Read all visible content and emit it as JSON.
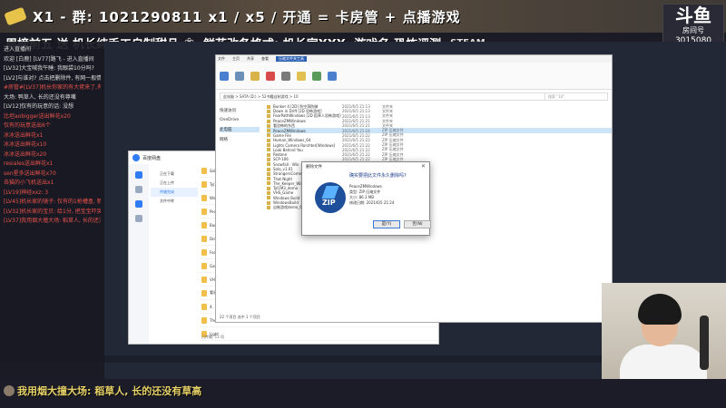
{
  "banner": {
    "text": "X1 - 群: 1021290811 x1 / x5 / 开通 = 卡房管 + 点播游戏",
    "sub": "周榜前五 送 机长纯手工自制甜品",
    "sub2": "鲜花改各格式: 机长家XXX, 游戏名,恐怖评测",
    "steam": "STEAM"
  },
  "logo": {
    "mark": "斗鱼",
    "sub": "房间号",
    "room_id": "3015080"
  },
  "chat": [
    {
      "text": "进入直播间",
      "hl": false
    },
    {
      "text": "欢迎 [白鹿] [LV77]路飞 - 进入直播间",
      "hl": false
    },
    {
      "text": "[LV32]大宝喊我午睡: 我眼袋10分吗?",
      "hl": false
    },
    {
      "text": "[LV2]与谁对? 点击把删除件, 有网一般情人就等你去打包",
      "hl": false
    },
    {
      "text": "#房管#[LV37]机长你家的有大佬来了,有请稍后",
      "hl": true
    },
    {
      "text": "大场: 鸭草人, 长的还没有尊嘴",
      "hl": false
    },
    {
      "text": "[LV12]仅有的玩意的话: 没想",
      "hl": false
    },
    {
      "text": "",
      "hl": false
    },
    {
      "text": "比坦aobigger送出鲜花x20",
      "gift": true
    },
    {
      "text": "仅有的玩意送出6个",
      "gift": true
    },
    {
      "text": "冰冰送出鲜花x1",
      "gift": true
    },
    {
      "text": "冰冰送出鲜花x10",
      "gift": true
    },
    {
      "text": "冰冰送出鲜花x20",
      "gift": true
    },
    {
      "text": "resiales送出鲜花x1",
      "gift": true
    },
    {
      "text": "sen星多送出鲜花x70",
      "gift": true
    },
    {
      "text": "去猫的小飞机送出x1",
      "gift": true
    },
    {
      "text": "",
      "hl": false
    },
    {
      "text": "[LV19]神经xxz: 3",
      "hl": true
    },
    {
      "text": "[LV45]机长家的镜子: 仅有的1枪槽盒, 新木友",
      "hl": true
    },
    {
      "text": "[LV32]机长家的宝贝: 给1分, 把宝宝吓哭了, 所以0分",
      "hl": true
    },
    {
      "text": "[LV37]我用烟大撞大场: 稻草人, 长的还没有草高",
      "hl": true
    }
  ],
  "bottom_message": "我用烟大撞大场: 稻草人, 长的还没有草高",
  "explorer": {
    "tabs": [
      "文件",
      "主页",
      "共享",
      "查看",
      "压缩文件夹工具"
    ],
    "active_tab": "压缩文件夹工具",
    "address": "此电脑 > SATA (D:) > 52书籍自制游戏 > 10",
    "search_placeholder": "搜索 \"10\"",
    "nav": [
      "快速访问",
      "OneDrive",
      "此电脑",
      "网络"
    ],
    "nav_selected": "此电脑",
    "files": [
      {
        "name": "Bunker 4 [2D] 防空洞防御",
        "date": "2021/6/5 21:13",
        "type": "文件夹"
      },
      {
        "name": "Down in Drift [2D 恐怖游戏]",
        "date": "2021/6/5 21:13",
        "type": "文件夹"
      },
      {
        "name": "FearPathWindows [2D 稻草人恐怖游戏]",
        "date": "2021/6/5 21:13",
        "type": "文件夹"
      },
      {
        "name": "PeaceZMWindows",
        "date": "2021/6/5 21:21",
        "type": "文件夹"
      },
      {
        "name": "看恐怖的东西",
        "date": "2021/6/5 21:21",
        "type": "文件夹"
      },
      {
        "name": "PeaceZMWindows",
        "date": "2021/6/5 21:24",
        "type": "ZIP 压缩文件",
        "sel": true
      },
      {
        "name": "Game File",
        "date": "2021/6/5 21:22",
        "type": "ZIP 压缩文件"
      },
      {
        "name": "Human_Windows_64",
        "date": "2021/6/5 21:22",
        "type": "ZIP 压缩文件"
      },
      {
        "name": "Lights Camera Rorshter[Windows]",
        "date": "2021/6/5 21:22",
        "type": "ZIP 压缩文件"
      },
      {
        "name": "Look Behind You",
        "date": "2021/6/5 21:22",
        "type": "ZIP 压缩文件"
      },
      {
        "name": "Redone",
        "date": "2021/6/5 21:22",
        "type": "ZIP 压缩文件"
      },
      {
        "name": "SCP-106",
        "date": "2021/6/5 21:22",
        "type": "ZIP 压缩文件"
      },
      {
        "name": "Snowfall - Win",
        "date": "2021/6/5 21:22",
        "type": "ZIP 压缩文件"
      },
      {
        "name": "Solo_v1.01",
        "date": "2021/6/5 21:22",
        "type": "ZIP 压缩文件"
      },
      {
        "name": "StrangersCome",
        "date": "2021/6/5 21:22",
        "type": "ZIP 压缩文件"
      },
      {
        "name": "That Night",
        "date": "2021/6/5 21:22",
        "type": "ZIP 压缩文件"
      },
      {
        "name": "The_Keeper_Win",
        "date": "2021/6/5 21:22",
        "type": "ZIP 压缩文件"
      },
      {
        "name": "Tyl1M3_demo",
        "date": "2021/6/5 21:22",
        "type": "ZIP 压缩文件"
      },
      {
        "name": "VHS_Game",
        "date": "2021/6/5 21:22",
        "type": "ZIP 压缩文件"
      },
      {
        "name": "Windows Build",
        "date": "2021/6/5 21:22",
        "type": "ZIP 压缩文件"
      },
      {
        "name": "WindowsBuild",
        "date": "2021/6/5 21:22",
        "type": "ZIP 压缩文件"
      },
      {
        "name": "自制游戏demo_64",
        "date": "2021/6/5 21:22",
        "type": "ZIP 压缩文件"
      }
    ],
    "status": "22 个项目  选中 1 个项目"
  },
  "dialog": {
    "title": "删除文件",
    "question": "确实要把此文件永久删除吗?",
    "name": "PeaceZMWindows",
    "type": "类型: ZIP 压缩文件",
    "size": "大小: 86.3 MB",
    "modified": "修改日期: 2021/6/5 21:24",
    "icon_text": "ZIP",
    "yes": "是(Y)",
    "no": "否(N)"
  },
  "baidu": {
    "title": "百度网盘",
    "nav": [
      "正在下载",
      "正在上传",
      "传输完成",
      "文件中转"
    ],
    "nav_selected": "传输完成",
    "rows": [
      "Solo",
      "Tyl1",
      "Windo",
      "Peac",
      "Bunke",
      "Down",
      "Fear",
      "Game",
      "VHS",
      "看恐",
      "4.",
      "The",
      "Light"
    ],
    "status": "已传输: 13 项"
  },
  "colors": {
    "chat_highlight": "#e8524a",
    "bottom_message": "#e8d26a",
    "accent": "#2f7cf6"
  }
}
